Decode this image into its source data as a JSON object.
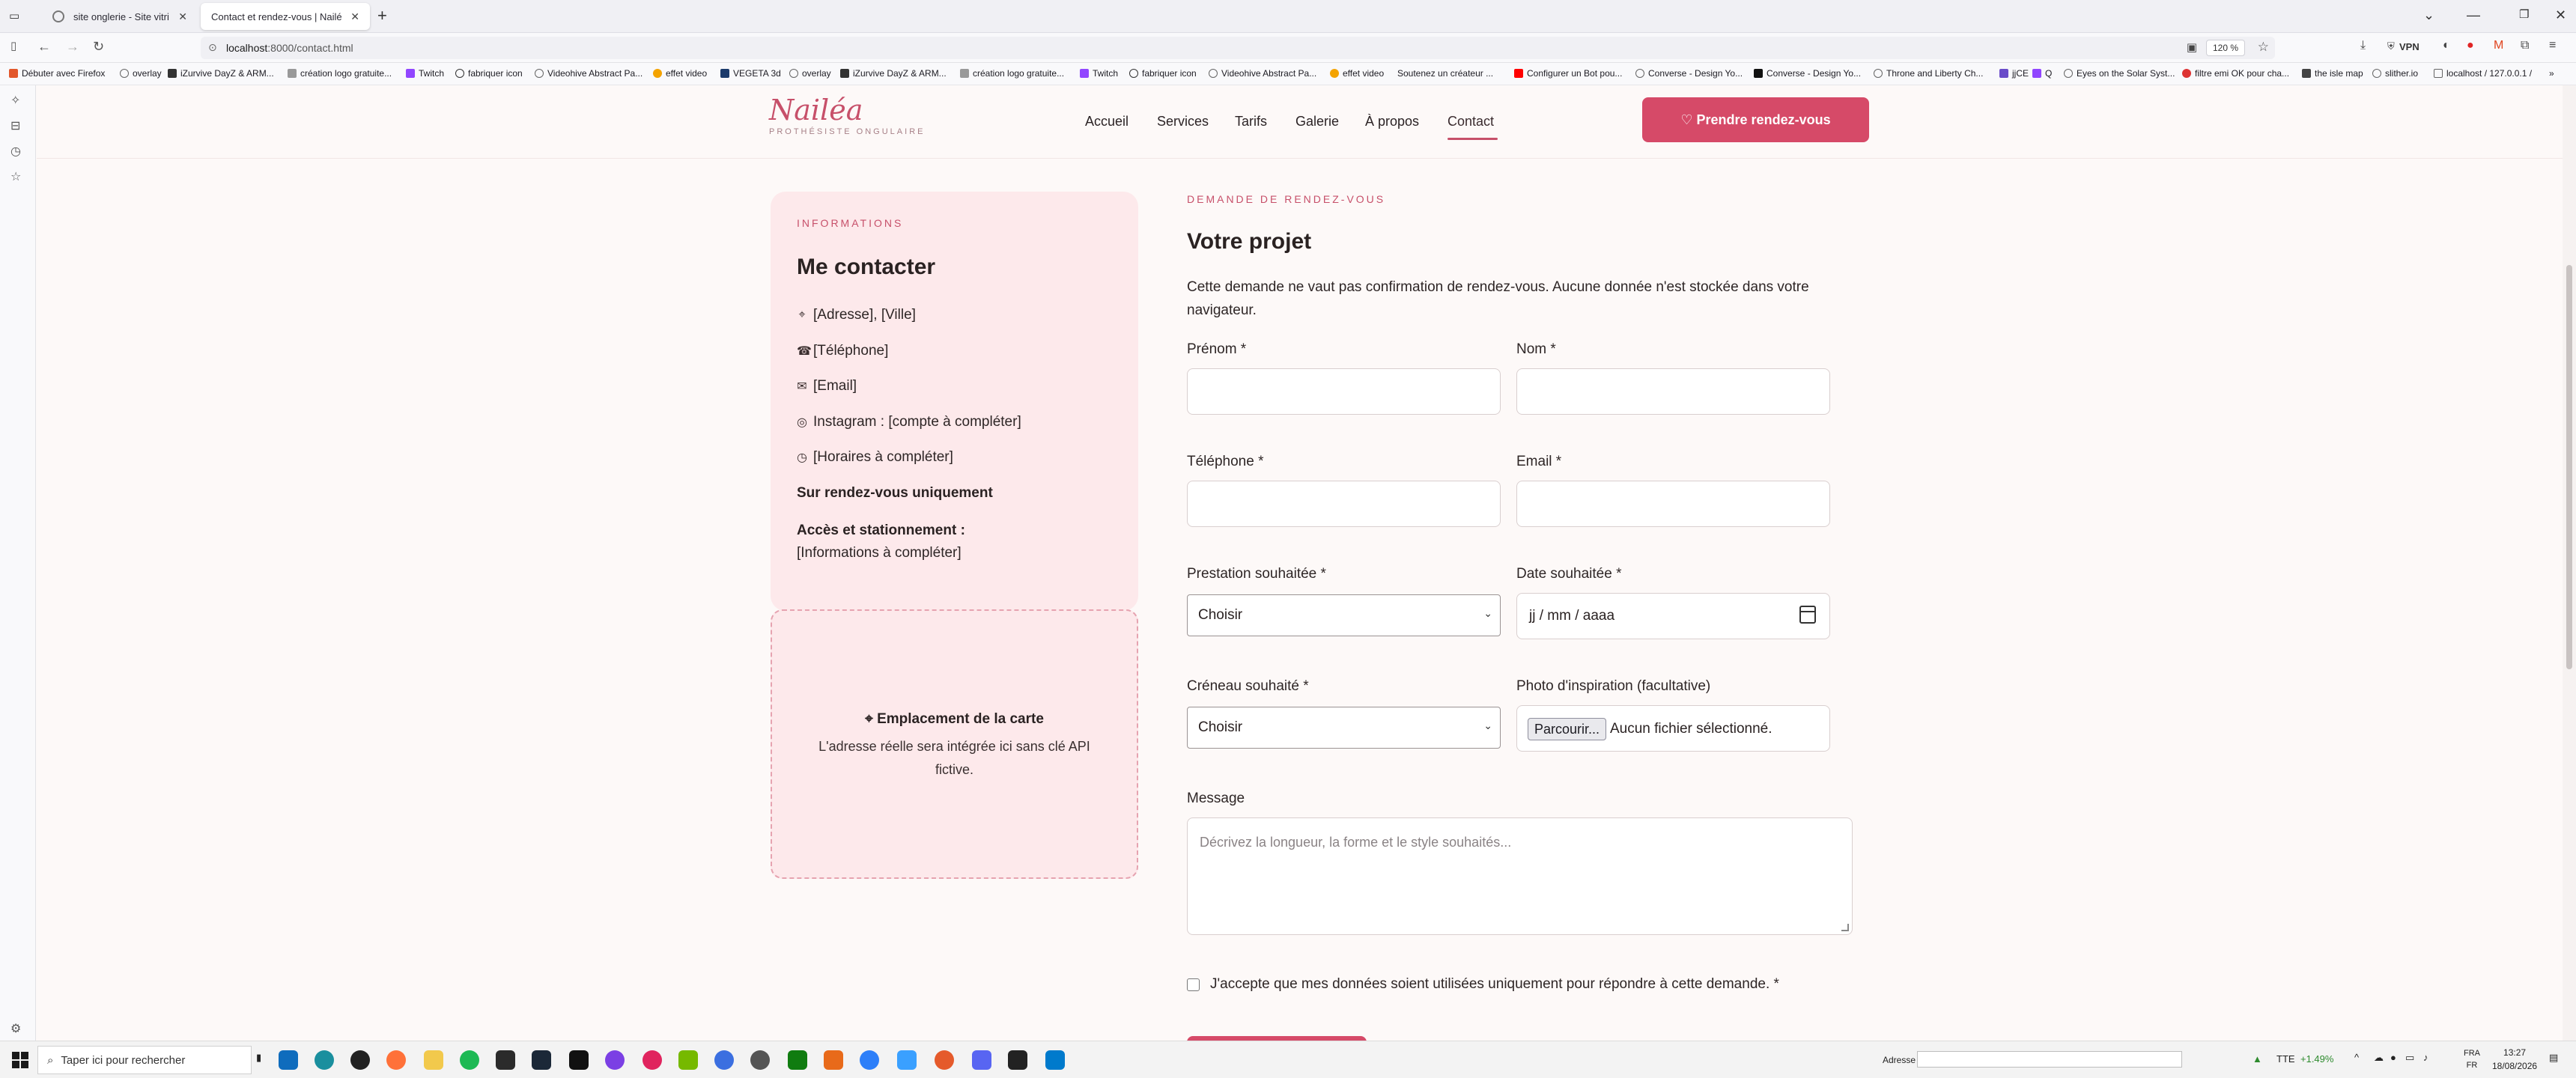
{
  "browser": {
    "tabs": [
      {
        "title": "site onglerie - Site vitrine proth",
        "active": false
      },
      {
        "title": "Contact et rendez-vous | Nailéa (Vi",
        "active": true
      }
    ],
    "url_host": "localhost",
    "url_path": ":8000/contact.html",
    "zoom": "120 %",
    "vpn_label": "VPN",
    "bookmarks": [
      "Débuter avec Firefox",
      "overlay",
      "iZurvive DayZ & ARM...",
      "création logo gratuite...",
      "Twitch",
      "fabriquer icon",
      "Videohive Abstract Pa...",
      "effet video",
      "VEGETA 3d",
      "overlay",
      "iZurvive DayZ & ARM...",
      "création logo gratuite...",
      "Twitch",
      "fabriquer icon",
      "Videohive Abstract Pa...",
      "effet video",
      "Soutenez un créateur ...",
      "Configurer un Bot pou...",
      "Converse - Design Yo...",
      "Converse - Design Yo...",
      "Throne and Liberty Ch...",
      "jjCE",
      "Q",
      "Eyes on the Solar Syst...",
      "filtre emi OK pour cha...",
      "the isle map",
      "slither.io",
      "localhost / 127.0.0.1 /"
    ]
  },
  "site": {
    "logo_name": "Nailéa",
    "logo_tagline": "PROTHÉSISTE ONGULAIRE",
    "nav": [
      "Accueil",
      "Services",
      "Tarifs",
      "Galerie",
      "À propos",
      "Contact"
    ],
    "cta": "♡ Prendre rendez-vous"
  },
  "info": {
    "eyebrow": "INFORMATIONS",
    "title": "Me contacter",
    "address": "[Adresse], [Ville]",
    "phone": "[Téléphone]",
    "email": "[Email]",
    "instagram": "Instagram : [compte à compléter]",
    "hours": "[Horaires à compléter]",
    "appointment_only": "Sur rendez-vous uniquement",
    "access_title": "Accès et stationnement :",
    "access_text": "[Informations à compléter]"
  },
  "map": {
    "title": "⌖ Emplacement de la carte",
    "desc": "L'adresse réelle sera intégrée ici sans clé API fictive."
  },
  "form": {
    "eyebrow": "DEMANDE DE RENDEZ-VOUS",
    "title": "Votre projet",
    "note": "Cette demande ne vaut pas confirmation de rendez-vous. Aucune donnée n'est stockée dans votre navigateur.",
    "first_name_label": "Prénom *",
    "last_name_label": "Nom *",
    "phone_label": "Téléphone *",
    "email_label": "Email *",
    "service_label": "Prestation souhaitée *",
    "service_value": "Choisir",
    "date_label": "Date souhaitée *",
    "date_value": "jj / mm / aaaa",
    "slot_label": "Créneau souhaité *",
    "slot_value": "Choisir",
    "photo_label": "Photo d'inspiration (facultative)",
    "file_button": "Parcourir...",
    "file_status": "Aucun fichier sélectionné.",
    "message_label": "Message",
    "message_placeholder": "Décrivez la longueur, la forme et le style souhaités...",
    "consent": "J'accepte que mes données soient utilisées uniquement pour répondre à cette demande. *"
  },
  "taskbar": {
    "search_placeholder": "Taper ici pour rechercher",
    "address_label": "Adresse",
    "stock": "TTE",
    "stock_change": "+1.49%",
    "lang": "FRA",
    "lang_sub": "FR",
    "time": "13:27",
    "date": "18/08/2026"
  },
  "colors": {
    "accent": "#d64a68",
    "card_bg": "#fde9eb",
    "page_bg": "#fdf9f8"
  }
}
